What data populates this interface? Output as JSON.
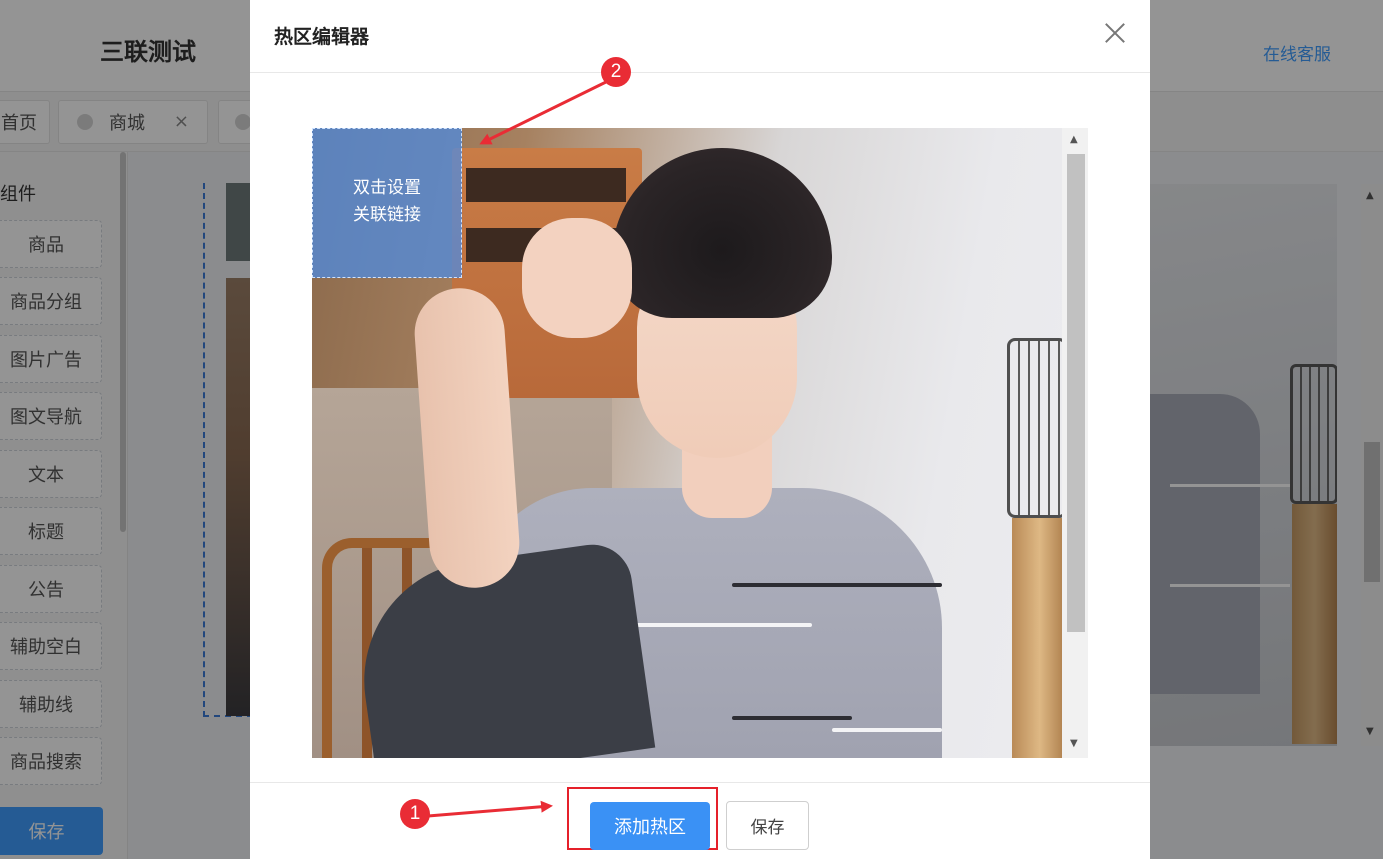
{
  "app": {
    "title": "三联测试",
    "online_service": "在线客服"
  },
  "tabs": [
    {
      "label": "首页"
    },
    {
      "label": "商城",
      "close": "×"
    },
    {
      "label": ""
    }
  ],
  "sidebar": {
    "heading": "组件",
    "items": [
      "商品",
      "商品分组",
      "图片广告",
      "图文导航",
      "文本",
      "标题",
      "公告",
      "辅助空白",
      "辅助线",
      "商品搜索"
    ],
    "save_label": "保存"
  },
  "dialog": {
    "title": "热区编辑器",
    "hotspot_text_line1": "双击设置",
    "hotspot_text_line2": "关联链接",
    "add_hotspot_label": "添加热区",
    "save_label": "保存"
  },
  "annotations": {
    "badge1": "1",
    "badge2": "2",
    "color": "#e92c35"
  },
  "colors": {
    "primary": "#3a91f5",
    "hotspot": "#4b8ce6",
    "link": "#409eff"
  },
  "icons": [
    "close-icon",
    "scroll-up-icon",
    "scroll-down-icon",
    "tab-close-icon"
  ]
}
